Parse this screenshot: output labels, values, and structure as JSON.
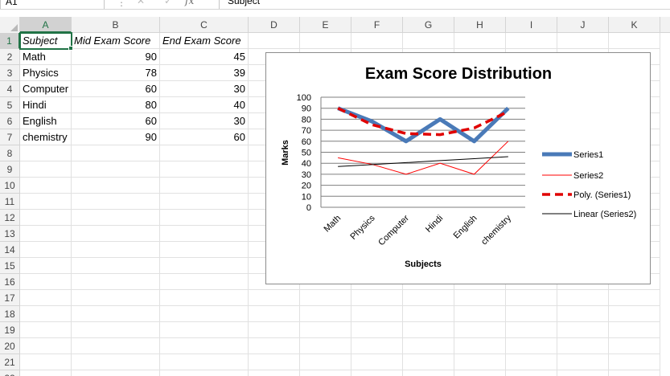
{
  "formula_bar": {
    "name_box": "A1",
    "cancel_icon": "✕",
    "enter_icon": "✓",
    "fx_label": "fx",
    "content": "Subject"
  },
  "columns": [
    "A",
    "B",
    "C",
    "D",
    "E",
    "F",
    "G",
    "H",
    "I",
    "J",
    "K"
  ],
  "rows": [
    "1",
    "2",
    "3",
    "4",
    "5",
    "6",
    "7",
    "8",
    "9",
    "10",
    "11",
    "12",
    "13",
    "14",
    "15",
    "16",
    "17",
    "18",
    "19",
    "20",
    "21",
    "22"
  ],
  "sheet": {
    "headers": [
      "Subject",
      "Mid Exam Score",
      "End Exam Score"
    ],
    "data": [
      [
        "Math",
        "90",
        "45"
      ],
      [
        "Physics",
        "78",
        "39"
      ],
      [
        "Computer",
        "60",
        "30"
      ],
      [
        "Hindi",
        "80",
        "40"
      ],
      [
        "English",
        "60",
        "30"
      ],
      [
        "chemistry",
        "90",
        "60"
      ]
    ]
  },
  "colors": {
    "accent": "#217346",
    "series1": "#4a7ab8",
    "series2": "#ff0000",
    "poly": "#e00000",
    "linear": "#000000"
  },
  "chart_data": {
    "type": "line",
    "title": "Exam Score Distribution",
    "xlabel": "Subjects",
    "ylabel": "Marks",
    "categories": [
      "Math",
      "Physics",
      "Computer",
      "Hindi",
      "English",
      "chemistry"
    ],
    "ylim": [
      0,
      100
    ],
    "yticks": [
      "0",
      "10",
      "20",
      "30",
      "40",
      "50",
      "60",
      "70",
      "80",
      "90",
      "100"
    ],
    "grid": true,
    "legend_position": "right",
    "series": [
      {
        "name": "Series1",
        "values": [
          90,
          78,
          60,
          80,
          60,
          90
        ]
      },
      {
        "name": "Series2",
        "values": [
          45,
          39,
          30,
          40,
          30,
          60
        ]
      }
    ],
    "trendlines": [
      {
        "name": "Poly. (Series1)",
        "values": [
          90,
          75,
          67,
          66,
          72,
          87
        ]
      },
      {
        "name": "Linear (Series2)",
        "values": [
          37,
          38.8,
          40.6,
          42.4,
          44.2,
          46
        ]
      }
    ]
  }
}
